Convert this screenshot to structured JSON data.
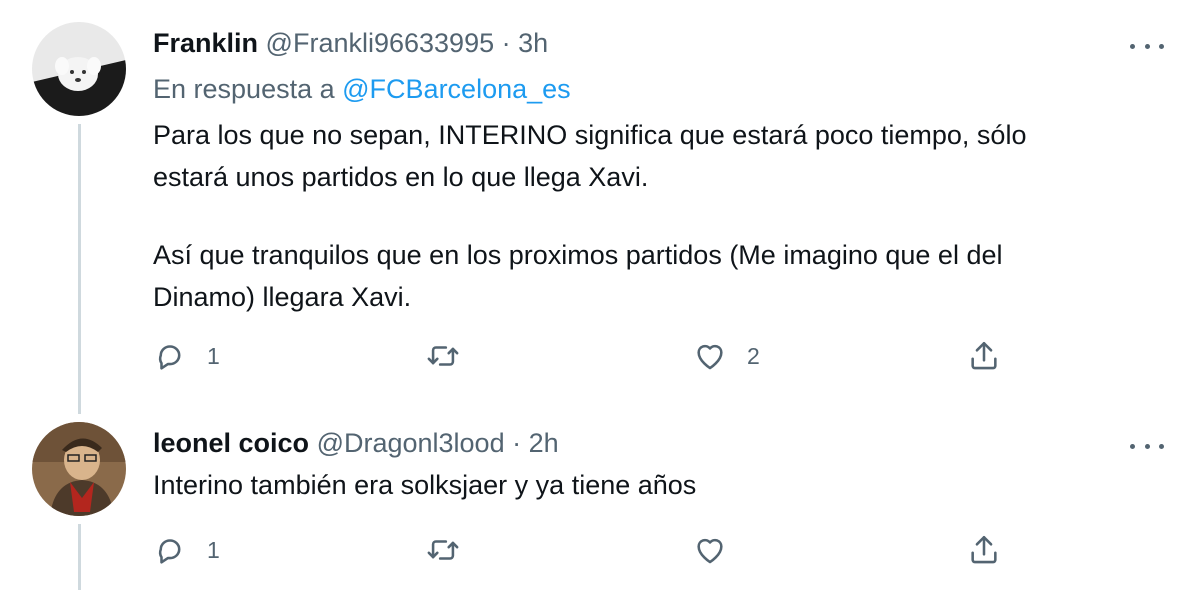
{
  "tweets": [
    {
      "name": "Franklin",
      "handle": "@Frankli96633995",
      "separator": "·",
      "time": "3h",
      "reply_prefix": "En respuesta a",
      "reply_mention": "@FCBarcelona_es",
      "text_line1": "Para los que no sepan, INTERINO significa que estará poco tiempo, sólo",
      "text_line2": "estará unos partidos en lo que llega Xavi.",
      "text_line3": "Así que tranquilos que en los proximos partidos (Me imagino que el del",
      "text_line4": "Dinamo) llegara Xavi.",
      "reply_count": "1",
      "like_count": "2"
    },
    {
      "name": "leonel coico",
      "handle": "@Dragonl3lood",
      "separator": "·",
      "time": "2h",
      "text_line1": "Interino también era solksjaer y ya tiene años",
      "reply_count": "1"
    }
  ],
  "icons": {
    "reply": "speech-bubble-icon",
    "retweet": "retweet-icon",
    "like": "heart-icon",
    "share": "share-icon",
    "more": "more-dots-icon"
  },
  "colors": {
    "text": "#0f1419",
    "secondary": "#536471",
    "link": "#1d9bf0",
    "thread_line": "#cfd9de"
  }
}
